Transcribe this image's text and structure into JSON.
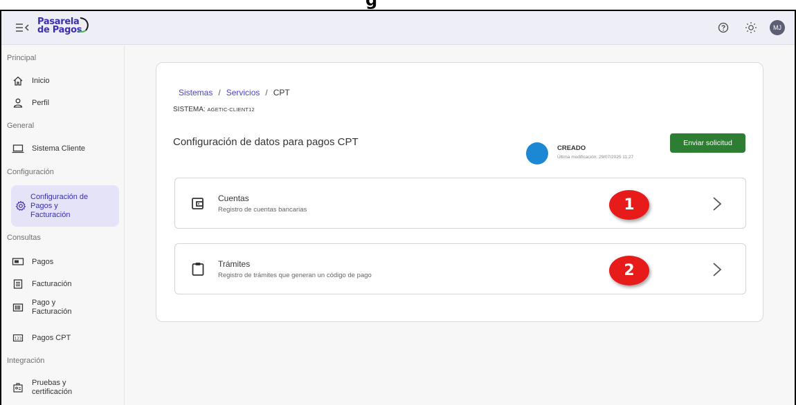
{
  "top_heading_partial": "g",
  "header": {
    "logo_line1": "Pasarela",
    "logo_line2": "de Pagos",
    "avatar_initials": "MJ"
  },
  "sidebar": {
    "sections": [
      {
        "title": "Principal"
      },
      {
        "title": "General"
      },
      {
        "title": "Configuración"
      },
      {
        "title": "Consultas"
      },
      {
        "title": "Integración"
      }
    ],
    "items": [
      {
        "label": "Inicio",
        "icon": "home-icon"
      },
      {
        "label": "Perfil",
        "icon": "user-icon"
      },
      {
        "label": "Sistema Cliente",
        "icon": "laptop-icon"
      },
      {
        "label_lines": [
          "Configuración de",
          "Pagos y",
          "Facturación"
        ],
        "icon": "gear-icon",
        "active": true
      },
      {
        "label": "Pagos",
        "icon": "money-icon"
      },
      {
        "label": "Facturación",
        "icon": "receipt-icon"
      },
      {
        "label_lines": [
          "Pago y",
          "Facturación"
        ],
        "icon": "barcode-icon"
      },
      {
        "label": "Pagos CPT",
        "icon": "number-tag-icon"
      },
      {
        "label_lines": [
          "Pruebas y",
          "certificación"
        ],
        "icon": "certificate-icon"
      }
    ]
  },
  "main": {
    "breadcrumb": [
      "Sistemas",
      "Servicios",
      "CPT"
    ],
    "sistema_label": "SISTEMA:",
    "sistema_value": "AGETIC-CLIENT12",
    "page_title": "Configuración de datos para pagos CPT",
    "status": {
      "label": "CREADO",
      "sub": "Última modificación: 29/07/2025 11:27",
      "color": "#1c88d4"
    },
    "send_button": "Enviar solicitud",
    "options": [
      {
        "title": "Cuentas",
        "subtitle": "Registro de cuentas bancarias",
        "badge": "1",
        "icon": "wallet-icon"
      },
      {
        "title": "Trámites",
        "subtitle": "Registro de trámites que generan un código de pago",
        "badge": "2",
        "icon": "clipboard-icon"
      }
    ]
  },
  "colors": {
    "accent": "#3a2fb0",
    "button_green": "#2d7d32",
    "badge_red": "#e81b1b",
    "active_nav_bg": "#e4e3f7"
  }
}
